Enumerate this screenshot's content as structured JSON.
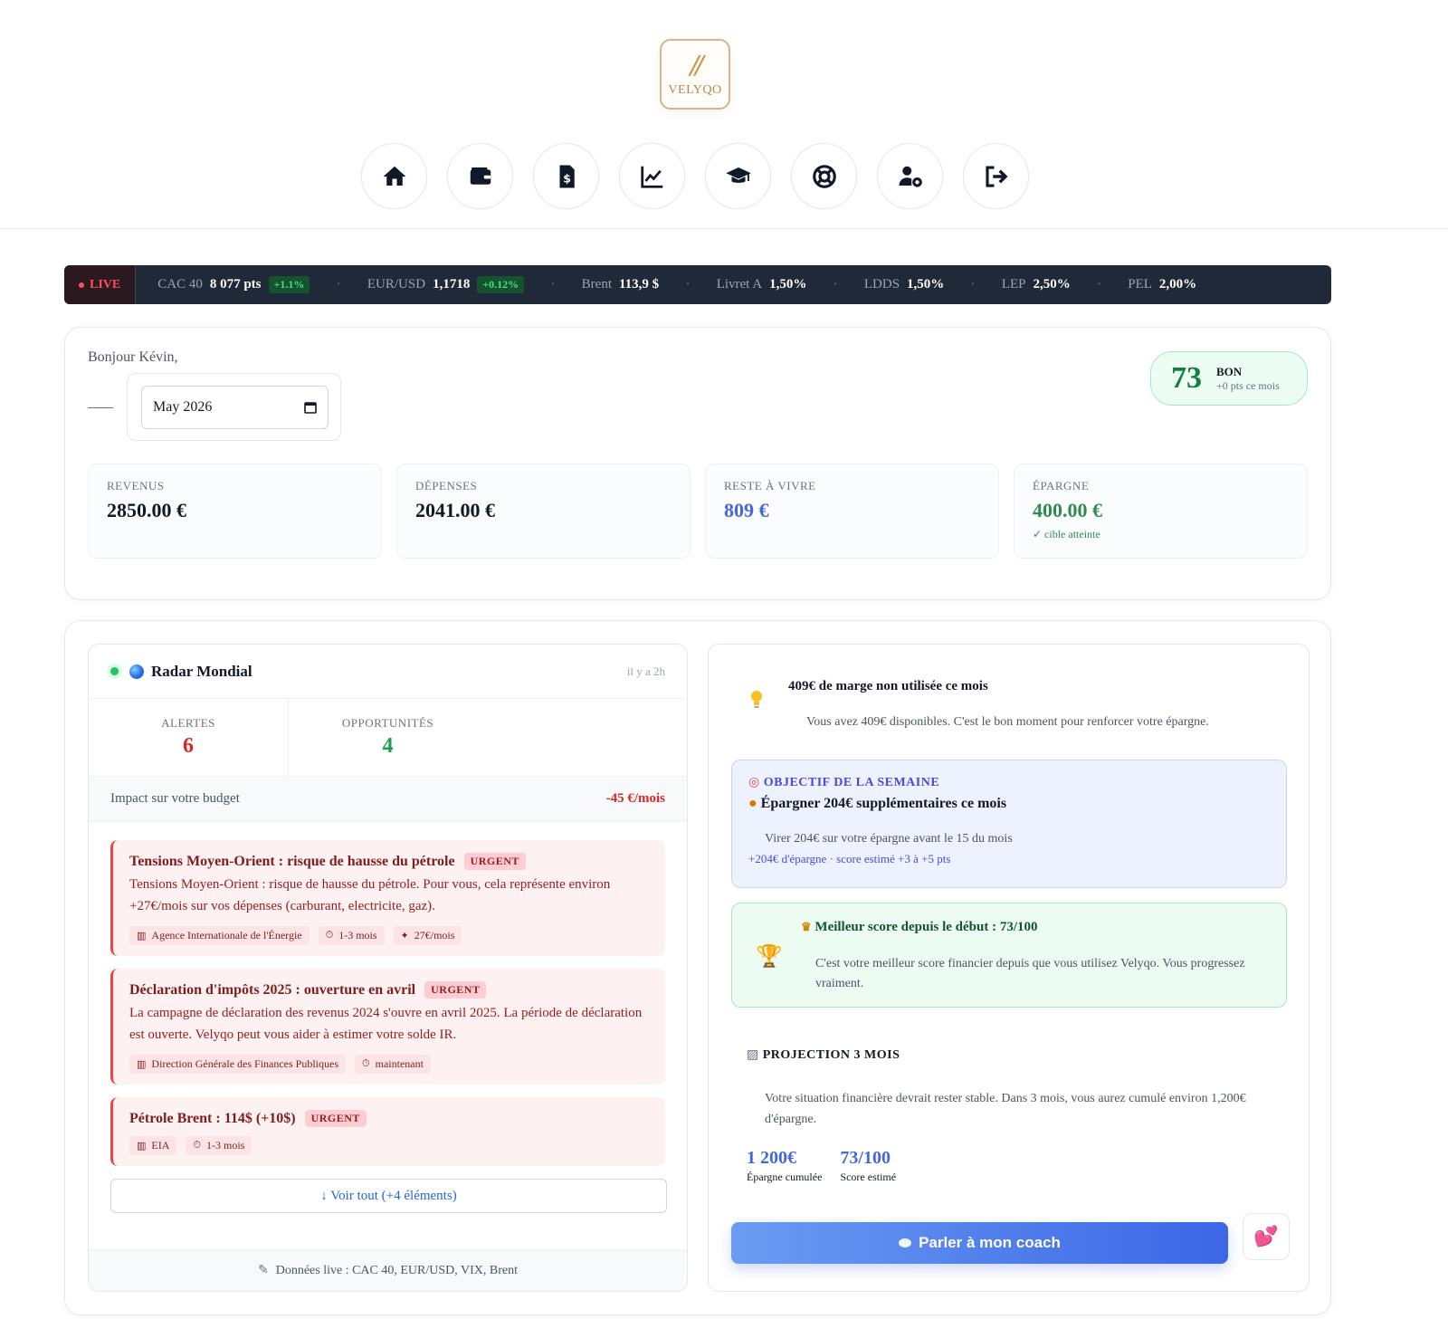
{
  "brand": {
    "name": "VELYQO",
    "mark": "//"
  },
  "nav": [
    {
      "name": "home-icon"
    },
    {
      "name": "wallet-icon"
    },
    {
      "name": "invoice-dollar-icon"
    },
    {
      "name": "chart-line-icon"
    },
    {
      "name": "graduation-cap-icon"
    },
    {
      "name": "lifebuoy-icon"
    },
    {
      "name": "user-gear-icon"
    },
    {
      "name": "logout-icon"
    }
  ],
  "ticker": {
    "live_label": "LIVE",
    "items": [
      {
        "label": "CAC 40",
        "value": "8 077 pts",
        "change": "+1.1%"
      },
      {
        "label": "EUR/USD",
        "value": "1,1718",
        "change": "+0.12%"
      },
      {
        "label": "Brent",
        "value": "113,9 $",
        "change": ""
      },
      {
        "label": "Livret A",
        "value": "1,50%",
        "change": ""
      },
      {
        "label": "LDDS",
        "value": "1,50%",
        "change": ""
      },
      {
        "label": "LEP",
        "value": "2,50%",
        "change": ""
      },
      {
        "label": "PEL",
        "value": "2,00%",
        "change": ""
      }
    ],
    "separator": "•"
  },
  "summary": {
    "greeting": "Bonjour Kévin,",
    "month": "May 2026",
    "score": {
      "value": "73",
      "level": "BON",
      "delta": "+0 pts ce mois"
    },
    "kpis": [
      {
        "title": "REVENUS",
        "value": "2850.00 €",
        "sub": ""
      },
      {
        "title": "DÉPENSES",
        "value": "2041.00 €",
        "sub": ""
      },
      {
        "title": "RESTE À VIVRE",
        "value": "809 €",
        "sub": ""
      },
      {
        "title": "ÉPARGNE",
        "value": "400.00 €",
        "sub": "✓ cible atteinte"
      }
    ]
  },
  "radar": {
    "title": "Radar Mondial",
    "updated": "il y a 2h",
    "alerts_label": "ALERTES",
    "alerts_count": "6",
    "opps_label": "OPPORTUNITÉS",
    "opps_count": "4",
    "impact_label": "Impact sur votre budget",
    "impact_value": "-45 €/mois",
    "items": [
      {
        "title": "Tensions Moyen-Orient : risque de hausse du pétrole",
        "badge": "URGENT",
        "desc": "Tensions Moyen-Orient : risque de hausse du pétrole. Pour vous, cela représente environ +27€/mois sur vos dépenses (carburant, electricite, gaz).",
        "source": "Agence Internationale de l'Énergie",
        "horizon": "1-3 mois",
        "cost": "27€/mois"
      },
      {
        "title": "Déclaration d'impôts 2025 : ouverture en avril",
        "badge": "URGENT",
        "desc": "La campagne de déclaration des revenus 2024 s'ouvre en avril 2025. La période de déclaration est ouverte. Velyqo peut vous aider à estimer votre solde IR.",
        "source": "Direction Générale des Finances Publiques",
        "horizon": "maintenant",
        "cost": ""
      },
      {
        "title": "Pétrole Brent : 114$ (+10$)",
        "badge": "URGENT",
        "desc": "",
        "source": "EIA",
        "horizon": "1-3 mois",
        "cost": ""
      }
    ],
    "more_label": "↓ Voir tout (+4 éléments)",
    "footer": "Données live : CAC 40, EUR/USD, VIX, Brent"
  },
  "coach": {
    "tip_title": "409€ de marge non utilisée ce mois",
    "tip_desc": "Vous avez 409€ disponibles. C'est le bon moment pour renforcer votre épargne.",
    "goal_header": "OBJECTIF DE LA SEMAINE",
    "goal_title": "Épargner 204€ supplémentaires ce mois",
    "goal_desc": "Virer 204€ sur votre épargne avant le 15 du mois",
    "goal_sub": "+204€ d'épargne · score estimé +3 à +5 pts",
    "best_title": "Meilleur score depuis le début : 73/100",
    "best_desc": "C'est votre meilleur score financier depuis que vous utilisez Velyqo. Vous progressez vraiment.",
    "proj_header": "PROJECTION 3 MOIS",
    "proj_desc": "Votre situation financière devrait rester stable. Dans 3 mois, vous aurez cumulé environ 1,200€ d'épargne.",
    "proj_values": [
      {
        "value": "1 200€",
        "label": "Épargne cumulée"
      },
      {
        "value": "73/100",
        "label": "Score estimé"
      }
    ],
    "cta": "Parler à mon coach"
  },
  "colors": {
    "accent": "#3b66e6",
    "danger": "#dc2626",
    "success": "#16a34a",
    "brand": "#c8963e"
  }
}
